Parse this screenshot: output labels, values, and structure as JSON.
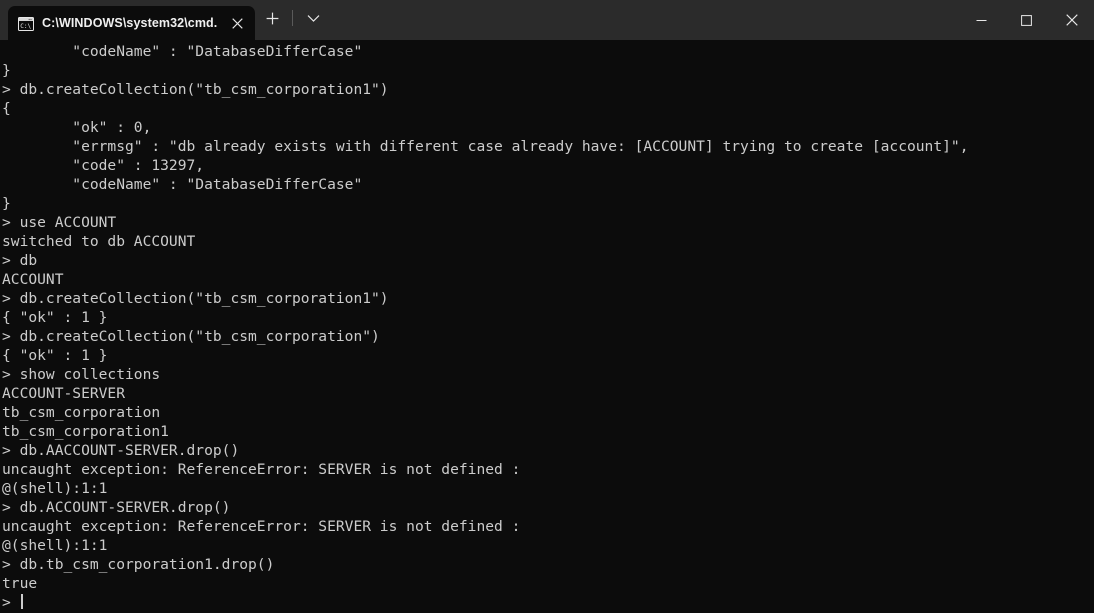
{
  "window": {
    "titlebar_bg": "#2b2b2b",
    "terminal_bg": "#0c0c0c",
    "text_color": "#cccccc"
  },
  "titlebar": {
    "tab": {
      "title": "C:\\WINDOWS\\system32\\cmd.",
      "icon": "cmd-console-icon",
      "close_label": "×"
    },
    "new_tab_label": "+",
    "dropdown_label": "⌄",
    "controls": {
      "minimize_label": "—",
      "maximize_label": "□",
      "close_label": "×"
    }
  },
  "terminal": {
    "prompt": "> ",
    "cursor_visible": true,
    "lines": [
      "        \"codeName\" : \"DatabaseDifferCase\"",
      "}",
      "> db.createCollection(\"tb_csm_corporation1\")",
      "{",
      "        \"ok\" : 0,",
      "        \"errmsg\" : \"db already exists with different case already have: [ACCOUNT] trying to create [account]\",",
      "        \"code\" : 13297,",
      "        \"codeName\" : \"DatabaseDifferCase\"",
      "}",
      "> use ACCOUNT",
      "switched to db ACCOUNT",
      "> db",
      "ACCOUNT",
      "> db.createCollection(\"tb_csm_corporation1\")",
      "{ \"ok\" : 1 }",
      "> db.createCollection(\"tb_csm_corporation\")",
      "{ \"ok\" : 1 }",
      "> show collections",
      "ACCOUNT-SERVER",
      "tb_csm_corporation",
      "tb_csm_corporation1",
      "> db.AACCOUNT-SERVER.drop()",
      "uncaught exception: ReferenceError: SERVER is not defined :",
      "@(shell):1:1",
      "> db.ACCOUNT-SERVER.drop()",
      "uncaught exception: ReferenceError: SERVER is not defined :",
      "@(shell):1:1",
      "> db.tb_csm_corporation1.drop()",
      "true"
    ],
    "last_prompt": ">"
  }
}
